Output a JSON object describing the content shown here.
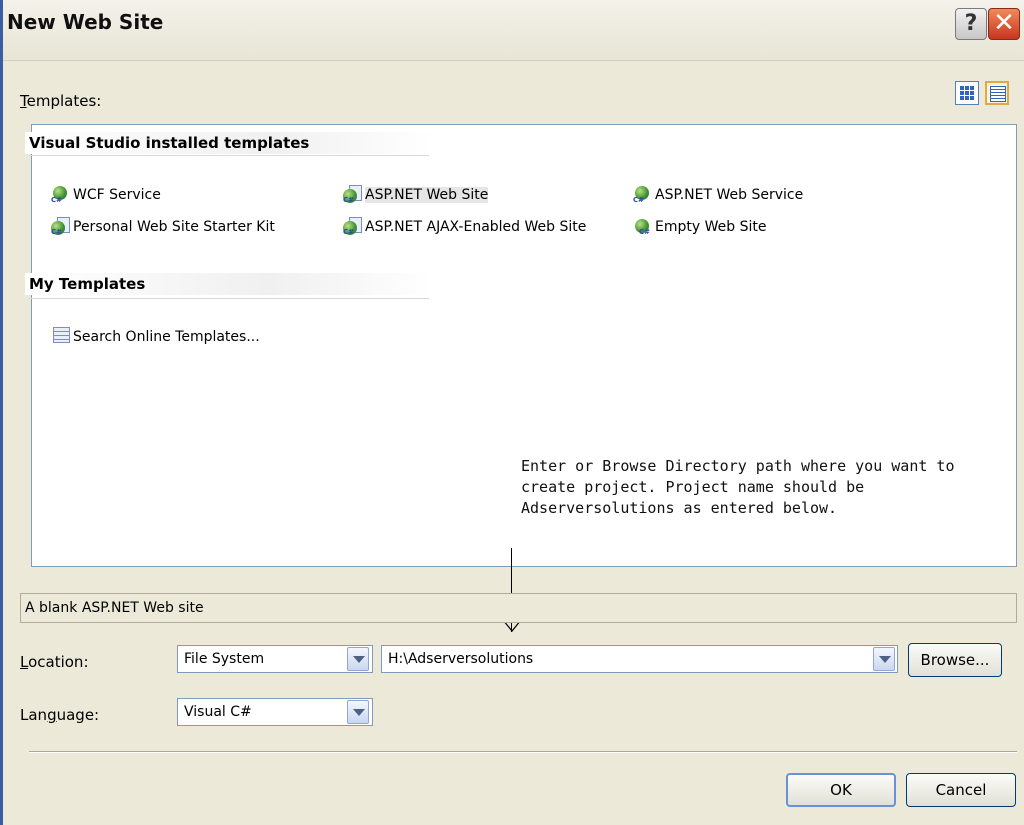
{
  "window": {
    "title": "New Web Site",
    "help_label": "?",
    "close_label": "✕"
  },
  "templates": {
    "label": "Templates:",
    "groups": [
      {
        "header": "Visual Studio installed templates",
        "items": [
          {
            "label": "WCF Service",
            "icon": "wcf-service-icon"
          },
          {
            "label": "ASP.NET Web Site",
            "icon": "aspnet-web-site-icon",
            "selected": true
          },
          {
            "label": "ASP.NET Web Service",
            "icon": "aspnet-web-service-icon"
          },
          {
            "label": "Personal Web Site Starter Kit",
            "icon": "personal-web-site-icon"
          },
          {
            "label": "ASP.NET AJAX-Enabled Web Site",
            "icon": "ajax-web-site-icon"
          },
          {
            "label": "Empty Web Site",
            "icon": "empty-web-site-icon"
          }
        ]
      },
      {
        "header": "My Templates",
        "items": [
          {
            "label": "Search Online Templates...",
            "icon": "search-online-icon"
          }
        ]
      }
    ]
  },
  "annotation": {
    "lines": [
      "Enter or Browse Directory path where you want to",
      "create project. Project name should be",
      "Adserversolutions as entered below."
    ]
  },
  "description": "A blank ASP.NET Web site",
  "location": {
    "label": "Location:",
    "type_value": "File System",
    "path_value": "H:\\Adserversolutions",
    "browse_label": "Browse..."
  },
  "language": {
    "label": "Language:",
    "value": "Visual C#"
  },
  "buttons": {
    "ok": "OK",
    "cancel": "Cancel"
  }
}
